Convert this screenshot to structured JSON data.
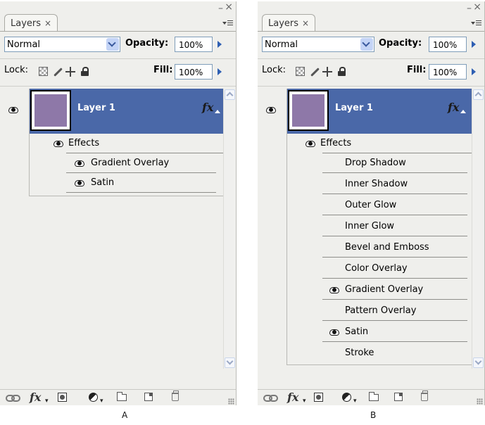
{
  "panels": [
    {
      "caption": "A",
      "tab_label": "Layers",
      "tab_close": "×",
      "window_min": "–",
      "window_close": "×",
      "blend_mode": "Normal",
      "opacity_label": "Opacity:",
      "opacity_value": "100%",
      "lock_label": "Lock:",
      "fill_label": "Fill:",
      "fill_value": "100%",
      "layer_name": "Layer 1",
      "layer_fx": "fx",
      "layer_color": "#8e78a8",
      "effects_label": "Effects",
      "effects": [
        {
          "name": "Gradient Overlay",
          "visible": true
        },
        {
          "name": "Satin",
          "visible": true
        }
      ],
      "bottom_fx": "fx"
    },
    {
      "caption": "B",
      "tab_label": "Layers",
      "tab_close": "×",
      "window_min": "–",
      "window_close": "×",
      "blend_mode": "Normal",
      "opacity_label": "Opacity:",
      "opacity_value": "100%",
      "lock_label": "Lock:",
      "fill_label": "Fill:",
      "fill_value": "100%",
      "layer_name": "Layer 1",
      "layer_fx": "fx",
      "layer_color": "#8e78a8",
      "effects_label": "Effects",
      "effects": [
        {
          "name": "Drop Shadow",
          "visible": false
        },
        {
          "name": "Inner Shadow",
          "visible": false
        },
        {
          "name": "Outer Glow",
          "visible": false
        },
        {
          "name": "Inner Glow",
          "visible": false
        },
        {
          "name": "Bevel and Emboss",
          "visible": false
        },
        {
          "name": "Color Overlay",
          "visible": false
        },
        {
          "name": "Gradient Overlay",
          "visible": true
        },
        {
          "name": "Pattern Overlay",
          "visible": false
        },
        {
          "name": "Satin",
          "visible": true
        },
        {
          "name": "Stroke",
          "visible": false
        }
      ],
      "bottom_fx": "fx"
    }
  ],
  "colors": {
    "selected_layer": "#4a68a8",
    "panel_bg": "#efefec",
    "accent_arrow": "#2e5fb3"
  }
}
